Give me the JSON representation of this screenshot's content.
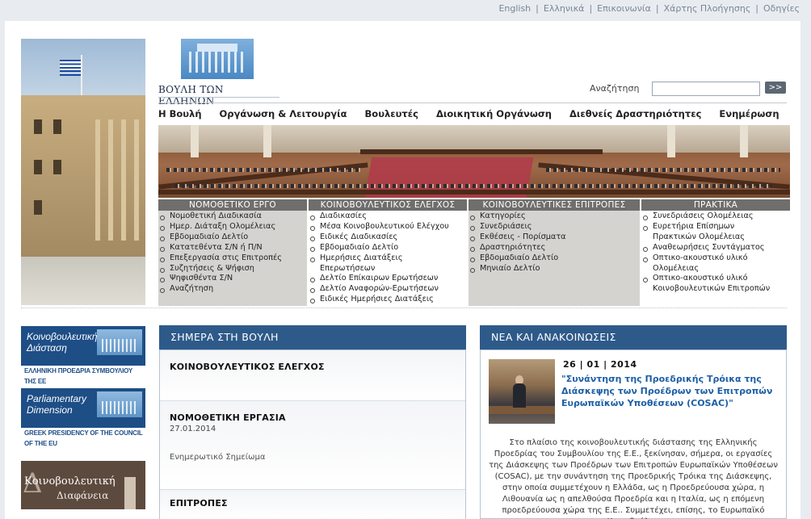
{
  "toplinks": [
    "English",
    "Ελληνικά",
    "Επικοινωνία",
    "Χάρτης Πλοήγησης",
    "Οδηγίες"
  ],
  "logo_text": "ΒΟΥΛΗ ΤΩΝ ΕΛΛΗΝΩΝ",
  "search": {
    "label": "Αναζήτηση",
    "button": ">>",
    "value": "",
    "placeholder": ""
  },
  "nav": [
    "Η Βουλή",
    "Οργάνωση & Λειτουργία",
    "Βουλευτές",
    "Διοικητική Οργάνωση",
    "Διεθνείς Δραστηριότητες",
    "Ενημέρωση"
  ],
  "sections": [
    {
      "title": "ΝΟΜΟΘΕΤΙΚΟ ΕΡΓΟ",
      "items": [
        "Νομοθετική Διαδικασία",
        "Ημερ. Διάταξη Ολομέλειας",
        "Εβδομαδιαίο Δελτίο",
        "Κατατεθέντα Σ/Ν ή Π/Ν",
        "Επεξεργασία στις Επιτροπές",
        "Συζητήσεις & Ψήφιση",
        "Ψηφισθέντα Σ/Ν",
        "Αναζήτηση"
      ]
    },
    {
      "title": "ΚΟΙΝΟΒΟΥΛΕΥΤΙΚΟΣ ΕΛΕΓΧΟΣ",
      "items": [
        "Διαδικασίες",
        "Μέσα Κοινοβουλευτικού Ελέγχου",
        "Ειδικές Διαδικασίες",
        "Εβδομαδιαίο Δελτίο",
        "Ημερήσιες Διατάξεις",
        "Επερωτήσεων",
        "Δελτίο Επίκαιρων Ερωτήσεων",
        "Δελτίο Αναφορών-Ερωτήσεων",
        "Ειδικές Ημερήσιες Διατάξεις"
      ]
    },
    {
      "title": "ΚΟΙΝΟΒΟΥΛΕΥΤΙΚΕΣ ΕΠΙΤΡΟΠΕΣ",
      "items": [
        "Κατηγορίες",
        "Συνεδριάσεις",
        "Εκθέσεις - Πορίσματα",
        "Δραστηριότητες",
        "Εβδομαδιαίο Δελτίο",
        "Μηνιαίο Δελτίο"
      ]
    },
    {
      "title": "ΠΡΑΚΤΙΚΑ",
      "items": [
        "Συνεδριάσεις Ολομέλειας",
        "Ευρετήρια Επίσημων",
        "Πρακτικών Ολομέλειας",
        "Αναθεωρήσεις Συντάγματος",
        "Οπτικο-ακουστικό υλικό",
        "Ολομέλειας",
        "Οπτικο-ακουστικό υλικό",
        "Κοινοβουλευτικών Επιτροπών"
      ]
    }
  ],
  "side_banners": [
    {
      "title_line1": "Κοινοβουλευτική",
      "title_line2": "Διάσταση",
      "subtitle": "ΕΛΛΗΝΙΚΗ ΠΡΟΕΔΡΙΑ ΣΥΜΒΟΥΛΙΟΥ ΤΗΣ ΕΕ"
    },
    {
      "title_line1": "Parliamentary",
      "title_line2": "Dimension",
      "subtitle": "GREEK PRESIDENCY OF THE COUNCIL OF THE EU"
    },
    {
      "title_line1": "Κοινοβουλευτική",
      "title_line2": "Διαφάνεια",
      "big_letter": "Δ"
    }
  ],
  "today": {
    "heading": "ΣΗΜΕΡΑ ΣΤΗ ΒΟΥΛΗ",
    "items": [
      {
        "title": "ΚΟΙΝΟΒΟΥΛΕΥΤΙΚΟΣ ΕΛΕΓΧΟΣ"
      },
      {
        "title": "ΝΟΜΟΘΕΤΙΚΗ ΕΡΓΑΣΙΑ",
        "date": "27.01.2014",
        "sub": "Ενημερωτικό Σημείωμα"
      },
      {
        "title": "ΕΠΙΤΡΟΠΕΣ"
      }
    ]
  },
  "news": {
    "heading": "ΝΕΑ ΚΑΙ ΑΝΑΚΟΙΝΩΣΕΙΣ",
    "date": "26 | 01 | 2014",
    "title": "\"Συνάντηση της Προεδρικής Τρόικα της Διάσκεψης των Προέδρων των Επιτροπών Ευρωπαϊκών Υποθέσεων (COSAC)\"",
    "body": "Στο πλαίσιο της κοινοβουλευτικής διάστασης της Ελληνικής Προεδρίας του Συμβουλίου της Ε.Ε., ξεκίνησαν, σήμερα, οι εργασίες της Διάσκεψης των Προέδρων των Επιτροπών Ευρωπαϊκών Υποθέσεων (COSAC), με την συνάντηση της Προεδρικής Τρόικα της Διάσκεψης, στην οποία συμμετέχουν η Ελλάδα, ως η Προεδρεύουσα χώρα, η Λιθουανία ως η απελθούσα Προεδρία και η Ιταλία, ως η επόμενη προεδρεύουσα χώρα της Ε.Ε.. Συμμετέχει, επίσης, το Ευρωπαϊκό Κοινοβούλιο."
  },
  "colors": {
    "accent": "#2e5a8a",
    "section_bar": "#6f6e6c",
    "news_title": "#1c5fa5"
  }
}
